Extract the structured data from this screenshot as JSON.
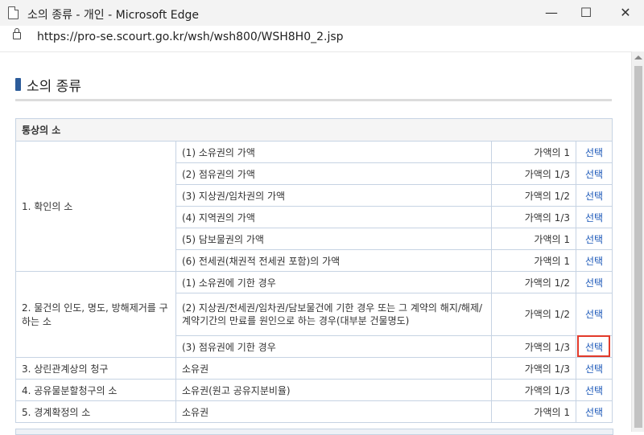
{
  "window": {
    "title": "소의 종류 - 개인 - Microsoft Edge",
    "minimize_glyph": "—",
    "maximize_glyph": "☐",
    "close_glyph": "✕"
  },
  "address": {
    "url": "https://pro-se.scourt.go.kr/wsh/wsh800/WSH8H0_2.jsp"
  },
  "page": {
    "heading": "소의 종류",
    "section_header": "통상의 소",
    "groups": [
      {
        "label": "1. 확인의 소",
        "rows": [
          {
            "desc": "(1) 소유권의 가액",
            "value": "가액의 1",
            "select": "선택"
          },
          {
            "desc": "(2) 점유권의 가액",
            "value": "가액의 1/3",
            "select": "선택"
          },
          {
            "desc": "(3) 지상권/임차권의 가액",
            "value": "가액의 1/2",
            "select": "선택"
          },
          {
            "desc": "(4) 지역권의 가액",
            "value": "가액의 1/3",
            "select": "선택"
          },
          {
            "desc": "(5) 담보물권의 가액",
            "value": "가액의 1",
            "select": "선택"
          },
          {
            "desc": "(6) 전세권(채권적 전세권 포함)의 가액",
            "value": "가액의 1",
            "select": "선택"
          }
        ]
      },
      {
        "label": "2. 물건의 인도, 명도, 방해제거를 구하는 소",
        "rows": [
          {
            "desc": "(1) 소유권에 기한 경우",
            "value": "가액의 1/2",
            "select": "선택"
          },
          {
            "desc": "(2) 지상권/전세권/임차권/담보물건에 기한 경우 또는 그 계약의 해지/해제/계약기간의 만료를 원인으로 하는 경우(대부분 건물명도)",
            "value": "가액의 1/2",
            "select": "선택"
          },
          {
            "desc": "(3) 점유권에 기한 경우",
            "value": "가액의 1/3",
            "select": "선택"
          }
        ]
      }
    ],
    "singles": [
      {
        "label": "3. 상린관계상의 청구",
        "desc": "소유권",
        "value": "가액의 1/3",
        "select": "선택"
      },
      {
        "label": "4. 공유물분할청구의 소",
        "desc": "소유권(원고 공유지분비율)",
        "value": "가액의 1/3",
        "select": "선택"
      },
      {
        "label": "5. 경계확정의 소",
        "desc": "소유권",
        "value": "가액의 1",
        "select": "선택"
      }
    ]
  }
}
